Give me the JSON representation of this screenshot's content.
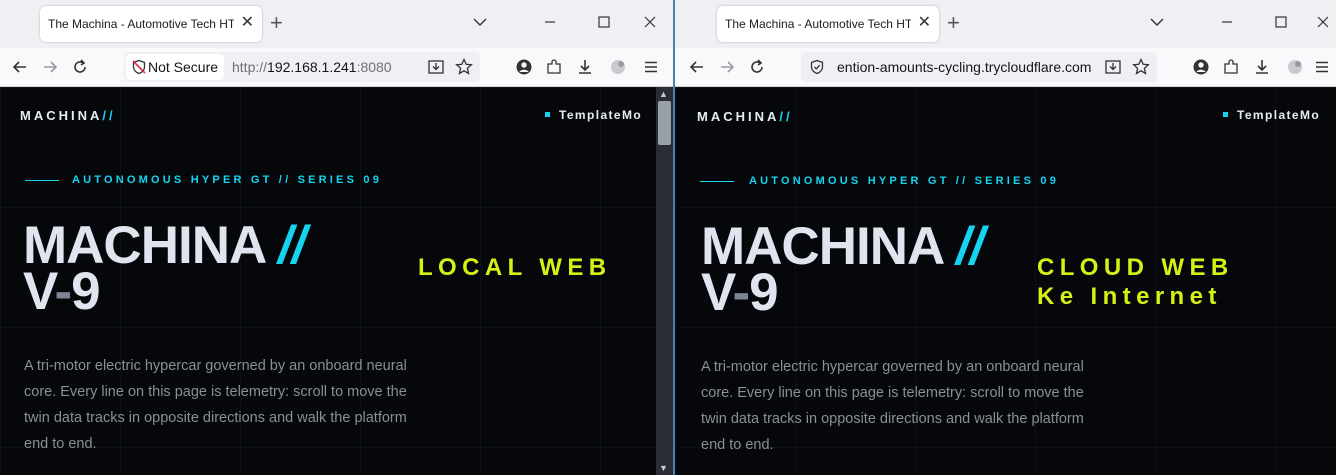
{
  "left_window": {
    "tab_title": "The Machina - Automotive Tech HTI",
    "security_label": "Not Secure",
    "url_scheme": "http://",
    "url_host": "192.168.1.241",
    "url_port": ":8080",
    "overlay_lines": [
      "LOCAL WEB"
    ]
  },
  "right_window": {
    "tab_title": "The Machina - Automotive Tech HTI",
    "url_host": "ention-amounts-cycling.trycloudflare.com",
    "overlay_lines": [
      "CLOUD WEB",
      "Ke Internet"
    ]
  },
  "site": {
    "brand_name": "MACHINA",
    "brand_slash": "//",
    "nav_link": "TemplateMo",
    "eyebrow": "AUTONOMOUS HYPER GT // SERIES 09",
    "hero_line1": "MACHINA",
    "hero_slash": "//",
    "hero_v": "V",
    "hero_dash": "-",
    "hero_9": "9",
    "description": "A tri-motor electric hypercar governed by an onboard neural core. Every line on this page is telemetry: scroll to move the twin data tracks in opposite directions and walk the platform end to end."
  },
  "colors": {
    "accent_cyan": "#16d4f0",
    "overlay_yellow": "#d7f014",
    "page_bg": "#05070b",
    "hero_text": "#dfe4ee"
  }
}
